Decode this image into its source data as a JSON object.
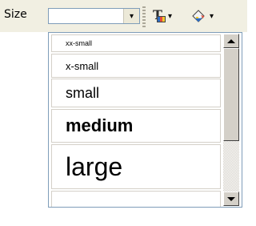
{
  "toolbar": {
    "size_label": "Size",
    "size_value": "",
    "dropdown_arrow": "▾",
    "text_color_icon": "text-color-icon",
    "text_color_letter": "T",
    "bg_color_icon": "background-color-icon"
  },
  "dropdown": {
    "items": [
      {
        "label": "xx-small",
        "font_size": "xx-small"
      },
      {
        "label": "x-small",
        "font_size": "x-small"
      },
      {
        "label": "small",
        "font_size": "small"
      },
      {
        "label": "medium",
        "font_size": "medium"
      },
      {
        "label": "large",
        "font_size": "large"
      },
      {
        "label": "",
        "font_size": "x-large"
      }
    ]
  },
  "colors": {
    "toolbar_bg": "#f1efe2",
    "border": "#7f9db9",
    "item_border": "#d4d0c8"
  }
}
